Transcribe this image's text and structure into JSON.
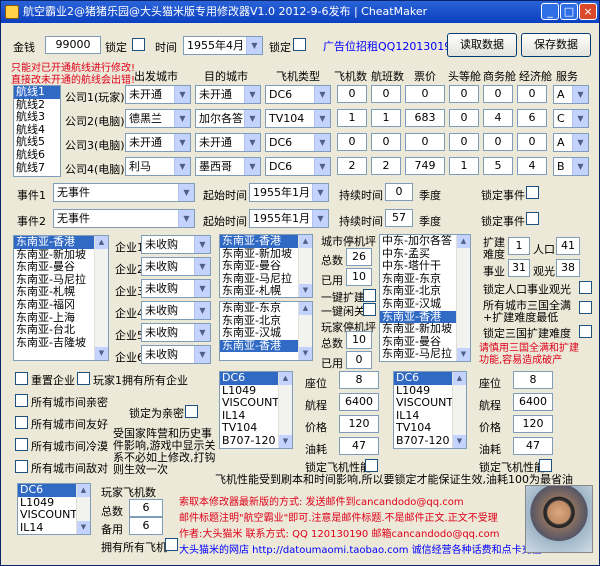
{
  "window": {
    "title": "航空霸业2@猪猪乐园@大头猫米版专用修改器V1.0   2012-9-6发布 | CheatMaker",
    "min": "_",
    "max": "□",
    "close": "×"
  },
  "top": {
    "money_label": "金钱",
    "money_value": "99000",
    "lock": "锁定",
    "time_label": "时间",
    "time_value": "1955年4月",
    "ad": "广告位招租QQ120130190",
    "read_btn": "读取数据",
    "save_btn": "保存数据"
  },
  "routes": {
    "warn1": "只能对已开通航线进行修改!",
    "warn2": "直接改未开通的航线会出错!",
    "list": [
      "航线1",
      "航线2",
      "航线3",
      "航线4",
      "航线5",
      "航线6",
      "航线7"
    ],
    "headers": {
      "from": "出发城市",
      "to": "目的城市",
      "plane": "飞机类型",
      "count": "飞机数",
      "flights": "航班数",
      "price": "票价",
      "first": "头等舱",
      "business": "商务舱",
      "economy": "经济舱",
      "service": "服务"
    },
    "rows": [
      {
        "name": "公司1(玩家)",
        "from": "未开通",
        "to": "未开通",
        "plane": "DC6",
        "count": "0",
        "flights": "0",
        "price": "0",
        "first": "0",
        "business": "0",
        "economy": "0",
        "service": "A"
      },
      {
        "name": "公司2(电脑)",
        "from": "德黑兰",
        "to": "加尔各答",
        "plane": "TV104",
        "count": "1",
        "flights": "1",
        "price": "683",
        "first": "0",
        "business": "4",
        "economy": "6",
        "service": "C"
      },
      {
        "name": "公司3(电脑)",
        "from": "未开通",
        "to": "未开通",
        "plane": "DC6",
        "count": "0",
        "flights": "0",
        "price": "0",
        "first": "0",
        "business": "0",
        "economy": "0",
        "service": "A"
      },
      {
        "name": "公司4(电脑)",
        "from": "利马",
        "to": "墨西哥",
        "plane": "DC6",
        "count": "2",
        "flights": "2",
        "price": "749",
        "first": "1",
        "business": "5",
        "economy": "4",
        "service": "B"
      }
    ]
  },
  "events": [
    {
      "label": "事件1",
      "value": "无事件",
      "start_label": "起始时间",
      "start": "1955年1月",
      "dur_label": "持续时间",
      "dur": "0",
      "season": "季度",
      "lock": "锁定事件"
    },
    {
      "label": "事件2",
      "value": "无事件",
      "start_label": "起始时间",
      "start": "1955年1月",
      "dur_label": "持续时间",
      "dur": "57",
      "season": "季度",
      "lock": "锁定事件"
    }
  ],
  "regions": [
    "东南亚-香港",
    "东南亚-新加坡",
    "东南亚-曼谷",
    "东南亚-马尼拉",
    "东南亚-札幌",
    "东南亚-福冈",
    "东南亚-上海",
    "东南亚-台北",
    "东南亚-吉隆坡"
  ],
  "companies": [
    {
      "label": "企业1",
      "value": "未收购"
    },
    {
      "label": "企业2",
      "value": "未收购"
    },
    {
      "label": "企业3",
      "value": "未收购"
    },
    {
      "label": "企业4",
      "value": "未收购"
    },
    {
      "label": "企业5",
      "value": "未收购"
    },
    {
      "label": "企业6",
      "value": "未收购"
    }
  ],
  "citylistA": [
    "东南亚-香港",
    "东南亚-新加坡",
    "东南亚-曼谷",
    "东南亚-马尼拉",
    "东南亚-札幌"
  ],
  "citylistB": [
    "东南亚-东京",
    "东南亚-北京",
    "东南亚-汉城",
    "东南亚-香港"
  ],
  "city_parking": {
    "title": "城市停机坪",
    "total_label": "总数",
    "total": "26",
    "used_label": "已用",
    "used": "10",
    "fill": "一键扩建",
    "clear": "一键闲关"
  },
  "player_parking": {
    "title": "玩家停机坪",
    "total_label": "总数",
    "total": "10",
    "used_label": "已用",
    "used": "0"
  },
  "citylistC": [
    "中东-加尔各答",
    "中东-孟买",
    "中东-塔什干",
    "东南亚-东京",
    "东南亚-北京",
    "东南亚-汉城",
    "东南亚-香港",
    "东南亚-新加坡",
    "东南亚-曼谷",
    "东南亚-马尼拉"
  ],
  "expand": {
    "label1": "扩建",
    "label2": "难度",
    "value": "1",
    "pop_label": "人口",
    "pop": "41",
    "biz_label": "事业",
    "biz": "31",
    "tour_label": "观光",
    "tour": "38",
    "lock_pop": "锁定人口事业观光",
    "all_max1": "所有城市三国全满",
    "all_max2": "+扩建难度最低",
    "lock_exp": "锁定三国扩建难度",
    "warn1": "请慎用三国全满和扩建",
    "warn2": "功能,容易造成破产"
  },
  "left_checks": {
    "reset": "重置企业",
    "own_all": "玩家1拥有所有企业",
    "friendly": "所有城市间亲密",
    "good": "所有城市间友好",
    "cold": "所有城市间冷漠",
    "hostile": "所有城市间敌对",
    "lock_close": "锁定为亲密"
  },
  "note": [
    "受国家阵营和历史事",
    "件影响,游戏中显示关",
    "系不必如上修改,打钩",
    "则生效一次"
  ],
  "plane_list1": [
    "DC6",
    "L1049",
    "VISCOUNT",
    "IL14",
    "TV104",
    "B707-120"
  ],
  "plane_list2": [
    "DC6",
    "L1049",
    "VISCOUNT",
    "IL14",
    "TV104",
    "B707-120"
  ],
  "perf1": {
    "seat_label": "座位",
    "seat": "8",
    "range_label": "航程",
    "range": "6400",
    "price_label": "价格",
    "price": "120",
    "fuel_label": "油耗",
    "fuel": "47",
    "lock": "锁定飞机性能"
  },
  "perf2": {
    "seat_label": "座位",
    "seat": "8",
    "range_label": "航程",
    "range": "6400",
    "price_label": "价格",
    "price": "120",
    "fuel_label": "油耗",
    "fuel": "47",
    "lock": "锁定飞机性能"
  },
  "perf_note": "飞机性能受到刷本和时间影响,所以要锁定才能保证生效,油耗100为最省油",
  "plane_list3": [
    "DC6",
    "L1049",
    "VISCOUNT",
    "IL14"
  ],
  "player_planes": {
    "title": "玩家飞机数",
    "total_label": "总数",
    "total": "6",
    "spare_label": "备用",
    "spare": "6",
    "own_all": "拥有所有飞机"
  },
  "footer": {
    "l1": "索取本修改器最新版的方式: 发送邮件到cancandodo@qq.com",
    "l2": "邮件标题注明\"航空霸业\"即可.注意是邮件标题.不是邮件正文.正文不受理",
    "l3": "作者:大头猫米 联系方式: QQ 120130190 邮箱cancandodo@qq.com",
    "l4": "大头猫米的网店 http://datoumaomi.taobao.com 诚信经营各种话费和点卡充值"
  },
  "colors": {
    "title": "#0a3fbf",
    "warn": "#e0001a",
    "link": "#0000ff",
    "select": "#316ac5"
  }
}
